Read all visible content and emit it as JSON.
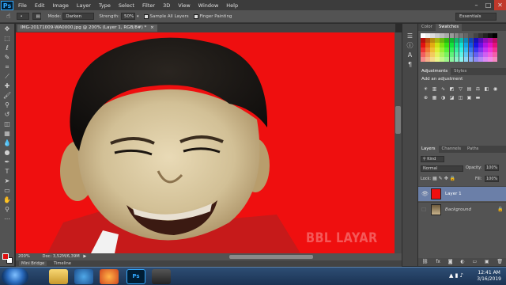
{
  "app": {
    "logo": "Ps"
  },
  "menu": [
    "File",
    "Edit",
    "Image",
    "Layer",
    "Type",
    "Select",
    "Filter",
    "3D",
    "View",
    "Window",
    "Help"
  ],
  "window_controls": [
    "–",
    "□",
    "✕"
  ],
  "options": {
    "mode_label": "Mode:",
    "mode_value": "Darken",
    "strength_label": "Strength:",
    "strength_value": "50%",
    "sample_all_layers": "Sample All Layers",
    "finger_painting": "Finger Painting",
    "workspace": "Essentials"
  },
  "document": {
    "tab_title": "IMG-20171009-WA0000.jpg @ 200% (Layer 1, RGB/8#) *",
    "zoom": "200%",
    "doc_info": "Doc: 3,52M/6,39M",
    "watermark": "BBL LAYAR",
    "canvas_color": "#ef0f0f"
  },
  "bottom_tabs": [
    "Mini Bridge",
    "Timeline"
  ],
  "panels": {
    "color_tabs": [
      "Color",
      "Swatches"
    ],
    "adjust_tabs": [
      "Adjustments",
      "Styles"
    ],
    "adjust_title": "Add an adjustment",
    "layers_tabs": [
      "Layers",
      "Channels",
      "Paths"
    ],
    "kind_label": "Kind",
    "blend_mode": "Normal",
    "opacity_label": "Opacity:",
    "opacity_value": "100%",
    "lock_label": "Lock:",
    "fill_label": "Fill:",
    "fill_value": "100%",
    "layers": [
      {
        "name": "Layer 1",
        "selected": true
      },
      {
        "name": "Background",
        "selected": false
      }
    ]
  },
  "taskbar": {
    "time": "12:41 AM",
    "date": "3/16/2019"
  },
  "icons": [
    "photoshop-logo",
    "eye-icon",
    "lock-icon",
    "search-icon"
  ],
  "colors": {
    "accent": "#31a8ff",
    "canvas_red": "#ef0f0f",
    "layer_selected": "#6b7fa8"
  }
}
